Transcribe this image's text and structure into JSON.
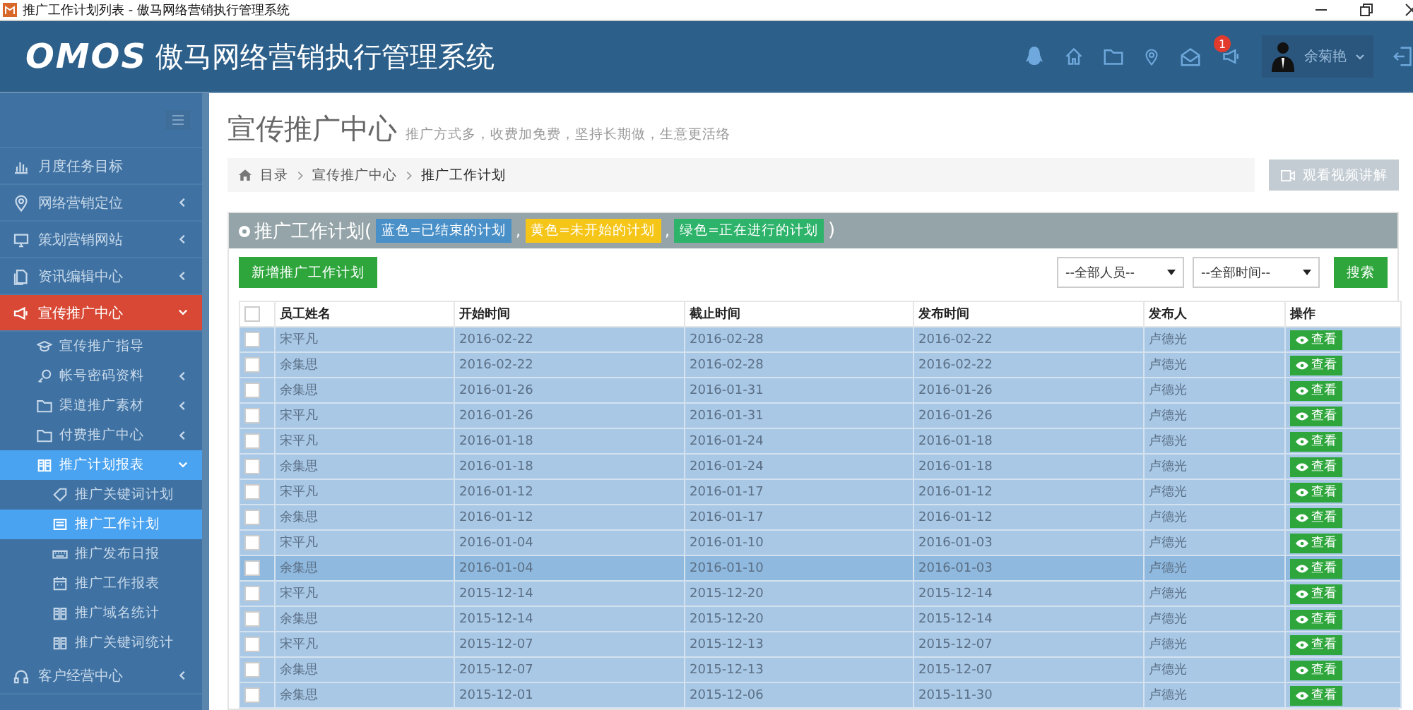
{
  "window": {
    "title": "推广工作计划列表 - 傲马网络营销执行管理系统"
  },
  "header": {
    "logo": "OMOS",
    "system_name": "傲马网络营销执行管理系统",
    "notification_count": "1",
    "user": "余菊艳"
  },
  "sidebar": {
    "items": [
      {
        "label": "月度任务目标",
        "selected": false
      },
      {
        "label": "网络营销定位",
        "selected": false,
        "expanded": false
      },
      {
        "label": "策划营销网站",
        "selected": false,
        "expanded": false
      },
      {
        "label": "资讯编辑中心",
        "selected": false,
        "expanded": false
      },
      {
        "label": "宣传推广中心",
        "selected": true,
        "expanded": true,
        "children": [
          {
            "label": "宣传推广指导",
            "selected": false
          },
          {
            "label": "帐号密码资料",
            "selected": false,
            "expanded": false
          },
          {
            "label": "渠道推广素材",
            "selected": false,
            "expanded": false
          },
          {
            "label": "付费推广中心",
            "selected": false,
            "expanded": false
          },
          {
            "label": "推广计划报表",
            "selected": true,
            "expanded": true,
            "children": [
              {
                "label": "推广关键词计划",
                "selected": false
              },
              {
                "label": "推广工作计划",
                "selected": true
              },
              {
                "label": "推广发布日报",
                "selected": false
              },
              {
                "label": "推广工作报表",
                "selected": false
              },
              {
                "label": "推广域名统计",
                "selected": false
              },
              {
                "label": "推广关键词统计",
                "selected": false
              }
            ]
          }
        ]
      },
      {
        "label": "客户经营中心",
        "selected": false,
        "expanded": false
      }
    ]
  },
  "page": {
    "title": "宣传推广中心",
    "subtitle": "推广方式多，收费加免费，坚持长期做，生意更活络",
    "breadcrumb": [
      "目录",
      "宣传推广中心",
      "推广工作计划"
    ],
    "video_button": "观看视频讲解"
  },
  "panel": {
    "title": "推广工作计划(",
    "legend": [
      {
        "label": "蓝色=已结束的计划",
        "color": "#4a90c8"
      },
      {
        "label": "黄色=未开始的计划",
        "color": "#f5c518"
      },
      {
        "label": "绿色=正在进行的计划",
        "color": "#2db36a"
      }
    ],
    "separators": [
      ",",
      ","
    ],
    "closing": ")",
    "new_button": "新增推广工作计划",
    "filters": [
      {
        "value": "--全部人员--"
      },
      {
        "value": "--全部时间--"
      }
    ],
    "search_button": "搜索"
  },
  "table": {
    "columns": [
      "员工姓名",
      "开始时间",
      "截止时间",
      "发布时间",
      "发布人",
      "操作"
    ],
    "all_checked": false,
    "rows": [
      {
        "name": "宋平凡",
        "start": "2016-02-22",
        "end": "2016-02-28",
        "published": "2016-02-22",
        "publisher": "卢德光",
        "action": "查看",
        "checked": false,
        "selected": false
      },
      {
        "name": "余集思",
        "start": "2016-02-22",
        "end": "2016-02-28",
        "published": "2016-02-22",
        "publisher": "卢德光",
        "action": "查看",
        "checked": false,
        "selected": false
      },
      {
        "name": "余集思",
        "start": "2016-01-26",
        "end": "2016-01-31",
        "published": "2016-01-26",
        "publisher": "卢德光",
        "action": "查看",
        "checked": false,
        "selected": false
      },
      {
        "name": "宋平凡",
        "start": "2016-01-26",
        "end": "2016-01-31",
        "published": "2016-01-26",
        "publisher": "卢德光",
        "action": "查看",
        "checked": false,
        "selected": false
      },
      {
        "name": "宋平凡",
        "start": "2016-01-18",
        "end": "2016-01-24",
        "published": "2016-01-18",
        "publisher": "卢德光",
        "action": "查看",
        "checked": false,
        "selected": false
      },
      {
        "name": "余集思",
        "start": "2016-01-18",
        "end": "2016-01-24",
        "published": "2016-01-18",
        "publisher": "卢德光",
        "action": "查看",
        "checked": false,
        "selected": false
      },
      {
        "name": "宋平凡",
        "start": "2016-01-12",
        "end": "2016-01-17",
        "published": "2016-01-12",
        "publisher": "卢德光",
        "action": "查看",
        "checked": false,
        "selected": false
      },
      {
        "name": "余集思",
        "start": "2016-01-12",
        "end": "2016-01-17",
        "published": "2016-01-12",
        "publisher": "卢德光",
        "action": "查看",
        "checked": false,
        "selected": false
      },
      {
        "name": "宋平凡",
        "start": "2016-01-04",
        "end": "2016-01-10",
        "published": "2016-01-03",
        "publisher": "卢德光",
        "action": "查看",
        "checked": false,
        "selected": false
      },
      {
        "name": "余集思",
        "start": "2016-01-04",
        "end": "2016-01-10",
        "published": "2016-01-03",
        "publisher": "卢德光",
        "action": "查看",
        "checked": false,
        "selected": true
      },
      {
        "name": "宋平凡",
        "start": "2015-12-14",
        "end": "2015-12-20",
        "published": "2015-12-14",
        "publisher": "卢德光",
        "action": "查看",
        "checked": false,
        "selected": false
      },
      {
        "name": "余集思",
        "start": "2015-12-14",
        "end": "2015-12-20",
        "published": "2015-12-14",
        "publisher": "卢德光",
        "action": "查看",
        "checked": false,
        "selected": false
      },
      {
        "name": "宋平凡",
        "start": "2015-12-07",
        "end": "2015-12-13",
        "published": "2015-12-07",
        "publisher": "卢德光",
        "action": "查看",
        "checked": false,
        "selected": false
      },
      {
        "name": "余集思",
        "start": "2015-12-07",
        "end": "2015-12-13",
        "published": "2015-12-07",
        "publisher": "卢德光",
        "action": "查看",
        "checked": false,
        "selected": false
      },
      {
        "name": "余集思",
        "start": "2015-12-01",
        "end": "2015-12-06",
        "published": "2015-11-30",
        "publisher": "卢德光",
        "action": "查看",
        "checked": false,
        "selected": false
      }
    ]
  }
}
